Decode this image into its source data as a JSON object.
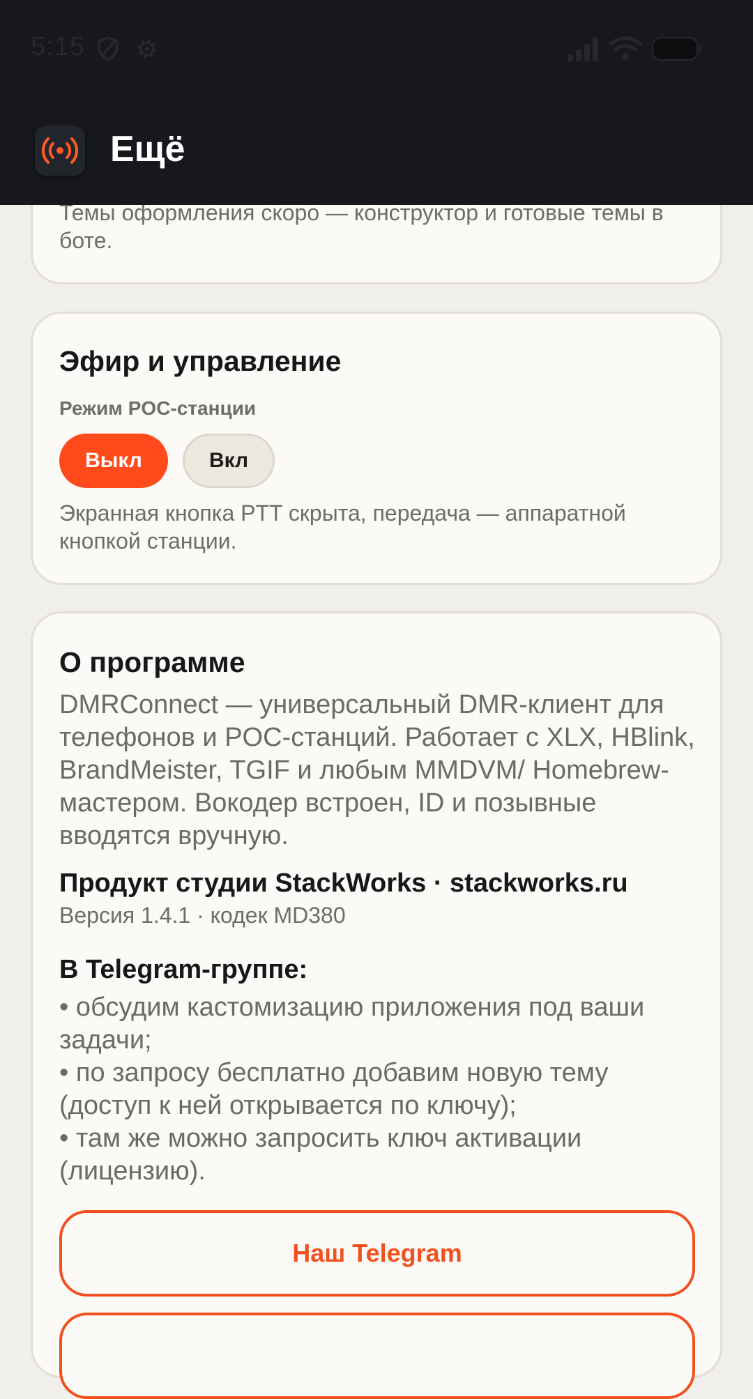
{
  "status_bar": {
    "time": "5:15",
    "icons": [
      "shield-icon",
      "gear-icon",
      "signal-icon",
      "wifi-icon",
      "battery-icon"
    ]
  },
  "header": {
    "title": "Ещё",
    "logo_icon": "broadcast-icon"
  },
  "themes_card": {
    "note": "Темы оформления скоро — конструктор и готовые темы в боте."
  },
  "air_card": {
    "title": "Эфир и управление",
    "poc_mode_label": "Режим POC-станции",
    "off_label": "Выкл",
    "on_label": "Вкл",
    "selected": "Выкл",
    "note": "Экранная кнопка PTT скрыта, передача — аппаратной кнопкой станции."
  },
  "about_card": {
    "title": "О программе",
    "description": "DMRConnect — универсальный DMR-клиент для телефонов и POC-станций. Работает с XLX, HBlink, BrandMeister, TGIF и любым MMDVM/ Homebrew-мастером. Вокодер встроен, ID и позывные вводятся вручную.",
    "product": "Продукт студии StackWorks · stackworks.ru",
    "version": "Версия 1.4.1 · кодек MD380",
    "telegram_heading": "В Telegram-группе:",
    "telegram_items": [
      "• обсудим кастомизацию приложения под ваши задачи;",
      "• по запросу бесплатно добавим новую тему (доступ к ней открывается по ключу);",
      "• там же можно запросить ключ активации (лицензию)."
    ],
    "telegram_button": "Наш Telegram"
  },
  "colors": {
    "accent": "#FF4A1C",
    "accent_outline": "#F0511F",
    "background": "#F1EFEA",
    "card": "#FBFAF7",
    "topbar": "#16181D"
  }
}
